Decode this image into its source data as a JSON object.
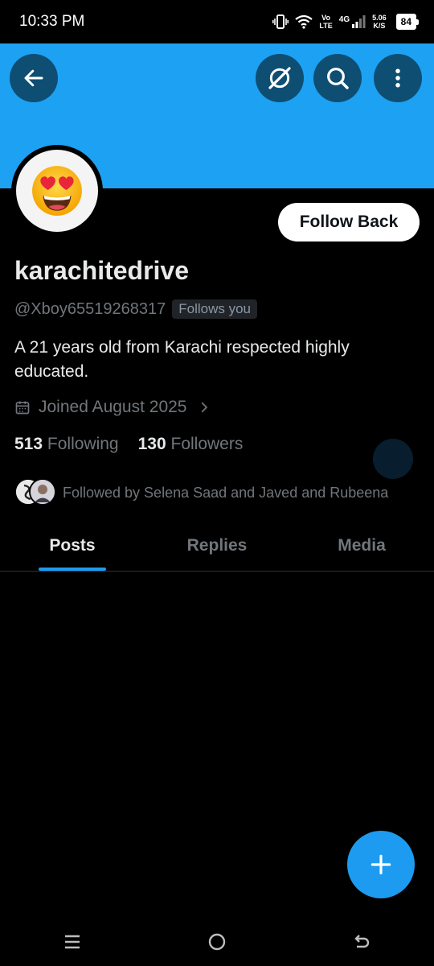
{
  "status_bar": {
    "time": "10:33 PM",
    "vo_top": "Vo",
    "vo_bottom": "LTE",
    "network": "4G",
    "speed_top": "5.06",
    "speed_bottom": "K/S",
    "battery": "84"
  },
  "header": {
    "banner_color": "#1da1f2",
    "back_icon": "arrow-left-icon",
    "grok_icon": "grok-icon",
    "search_icon": "search-icon",
    "more_icon": "more-vertical-icon"
  },
  "profile": {
    "avatar_icon": "heart-eyes-emoji",
    "follow_button": "Follow Back",
    "display_name": "karachitedrive",
    "handle": "@Xboy65519268317",
    "follows_you": "Follows you",
    "bio": "A 21 years old from Karachi respected highly educated.",
    "joined": "Joined August 2025",
    "following_count": "513",
    "following_label": "Following",
    "followers_count": "130",
    "followers_label": "Followers",
    "followed_by": "Followed by Selena Saad and Javed and Rubeena"
  },
  "tabs": [
    {
      "label": "Posts",
      "active": true
    },
    {
      "label": "Replies",
      "active": false
    },
    {
      "label": "Media",
      "active": false
    }
  ],
  "accent_color": "#1d9bf0",
  "fab_icon": "plus-icon",
  "nav": {
    "recents_icon": "menu-lines-icon",
    "home_icon": "circle-home-icon",
    "back_icon": "return-icon"
  }
}
